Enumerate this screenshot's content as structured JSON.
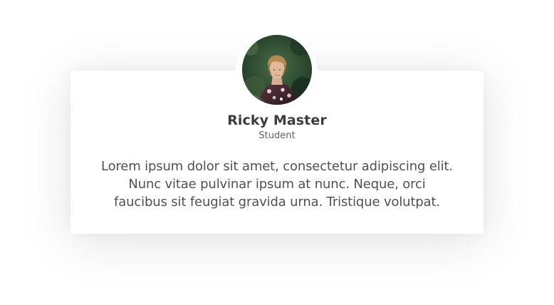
{
  "testimonial": {
    "name": "Ricky Master",
    "role": "Student",
    "quote": "Lorem ipsum dolor sit amet, consectetur adipiscing elit. Nunc vitae pulvinar ipsum at nunc. Neque, orci faucibus sit feugiat gravida urna. Tristique volutpat.",
    "avatar_icon": "person-photo-icon"
  },
  "colors": {
    "background": "#ffffff",
    "card": "#ffffff",
    "name_text": "#3c3c3c",
    "role_text": "#5f5f5f",
    "quote_text": "#505050"
  }
}
